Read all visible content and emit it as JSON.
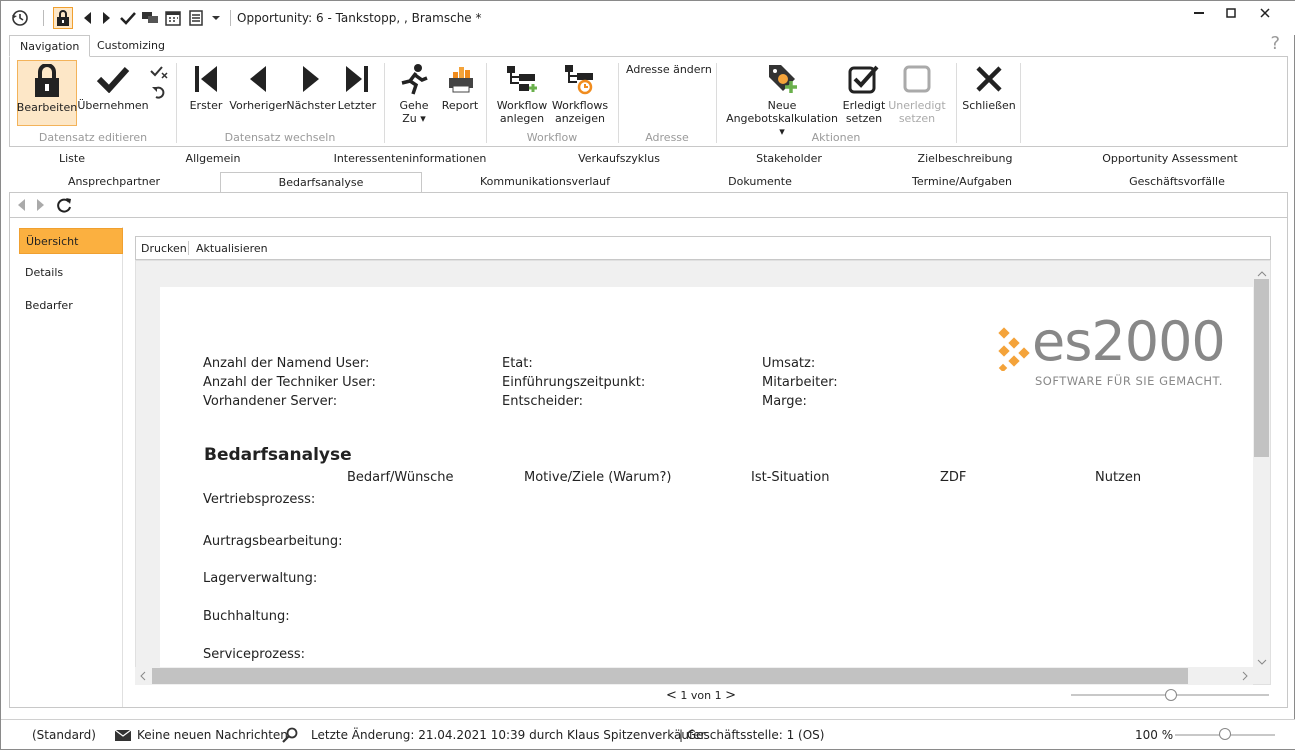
{
  "window": {
    "title": "Opportunity: 6 - Tankstopp, , Bramsche *",
    "minimize_icon": "minimize-icon",
    "maximize_icon": "maximize-icon",
    "close_icon": "close-icon"
  },
  "quick_access": {
    "icons": [
      "history-icon",
      "lock-icon",
      "prev-icon",
      "next-icon",
      "check-icon",
      "chat-icon",
      "calendar-icon",
      "list-icon",
      "dropdown-icon"
    ]
  },
  "ribbon_tabs": [
    {
      "label": "Navigation"
    },
    {
      "label": "Customizing"
    }
  ],
  "help_label": "?",
  "ribbon": {
    "bearbeiten": "Bearbeiten",
    "uebernehmen": "Übernehmen",
    "grp_datensatz_editieren": "Datensatz editieren",
    "erster": "Erster",
    "vorheriger": "Vorheriger",
    "naechster": "Nächster",
    "letzter": "Letzter",
    "grp_datensatz_wechseln": "Datensatz wechseln",
    "gehe_zu_1": "Gehe",
    "gehe_zu_2": "Zu",
    "report": "Report",
    "workflow_anlegen_1": "Workflow",
    "workflow_anlegen_2": "anlegen",
    "workflows_anzeigen_1": "Workflows",
    "workflows_anzeigen_2": "anzeigen",
    "grp_workflow": "Workflow",
    "adresse_aendern": "Adresse ändern",
    "grp_adresse": "Adresse",
    "neue_1": "Neue",
    "neue_2": "Angebotskalkulation",
    "erledigt_1": "Erledigt",
    "erledigt_2": "setzen",
    "unerledigt_1": "Unerledigt",
    "unerledigt_2": "setzen",
    "grp_aktionen": "Aktionen",
    "schliessen": "Schließen"
  },
  "form_tabs_row1": [
    "Liste",
    "Allgemein",
    "Interessenteninformationen",
    "Verkaufszyklus",
    "Stakeholder",
    "Zielbeschreibung",
    "Opportunity Assessment"
  ],
  "form_tabs_row2": [
    "Ansprechpartner",
    "Bedarfsanalyse",
    "Kommunikationsverlauf",
    "Dokumente",
    "Termine/Aufgaben",
    "Geschäftsvorfälle"
  ],
  "left_nav": [
    "Übersicht",
    "Details",
    "Bedarfer"
  ],
  "report_toolbar": {
    "drucken": "Drucken",
    "aktualisieren": "Aktualisieren"
  },
  "report": {
    "logo_main": "es2000",
    "logo_sub": "SOFTWARE FÜR SIE GEMACHT.",
    "labels_col1": [
      "Anzahl der Namend User:",
      "Anzahl der Techniker User:",
      "Vorhandener Server:"
    ],
    "labels_col2": [
      "Etat:",
      "Einführungszeitpunkt:",
      "Entscheider:"
    ],
    "labels_col3": [
      "Umsatz:",
      "Mitarbeiter:",
      "Marge:"
    ],
    "section_title": "Bedarfsanalyse",
    "columns": [
      "Bedarf/Wünsche",
      "Motive/Ziele (Warum?)",
      "Ist-Situation",
      "ZDF",
      "Nutzen"
    ],
    "rows": [
      "Vertriebsprozess:",
      "Aurtragsbearbeitung:",
      "Lagerverwaltung:",
      "Buchhaltung:",
      "Serviceprozess:"
    ]
  },
  "pager": {
    "label": "1 von 1"
  },
  "status": {
    "standard": "(Standard)",
    "messages": "Keine neuen Nachrichten",
    "last_change": "Letzte Änderung: 21.04.2021 10:39 durch Klaus Spitzenverkäufer",
    "branch": "| Geschäftsstelle:  1 (OS)",
    "zoom": "100 %"
  }
}
